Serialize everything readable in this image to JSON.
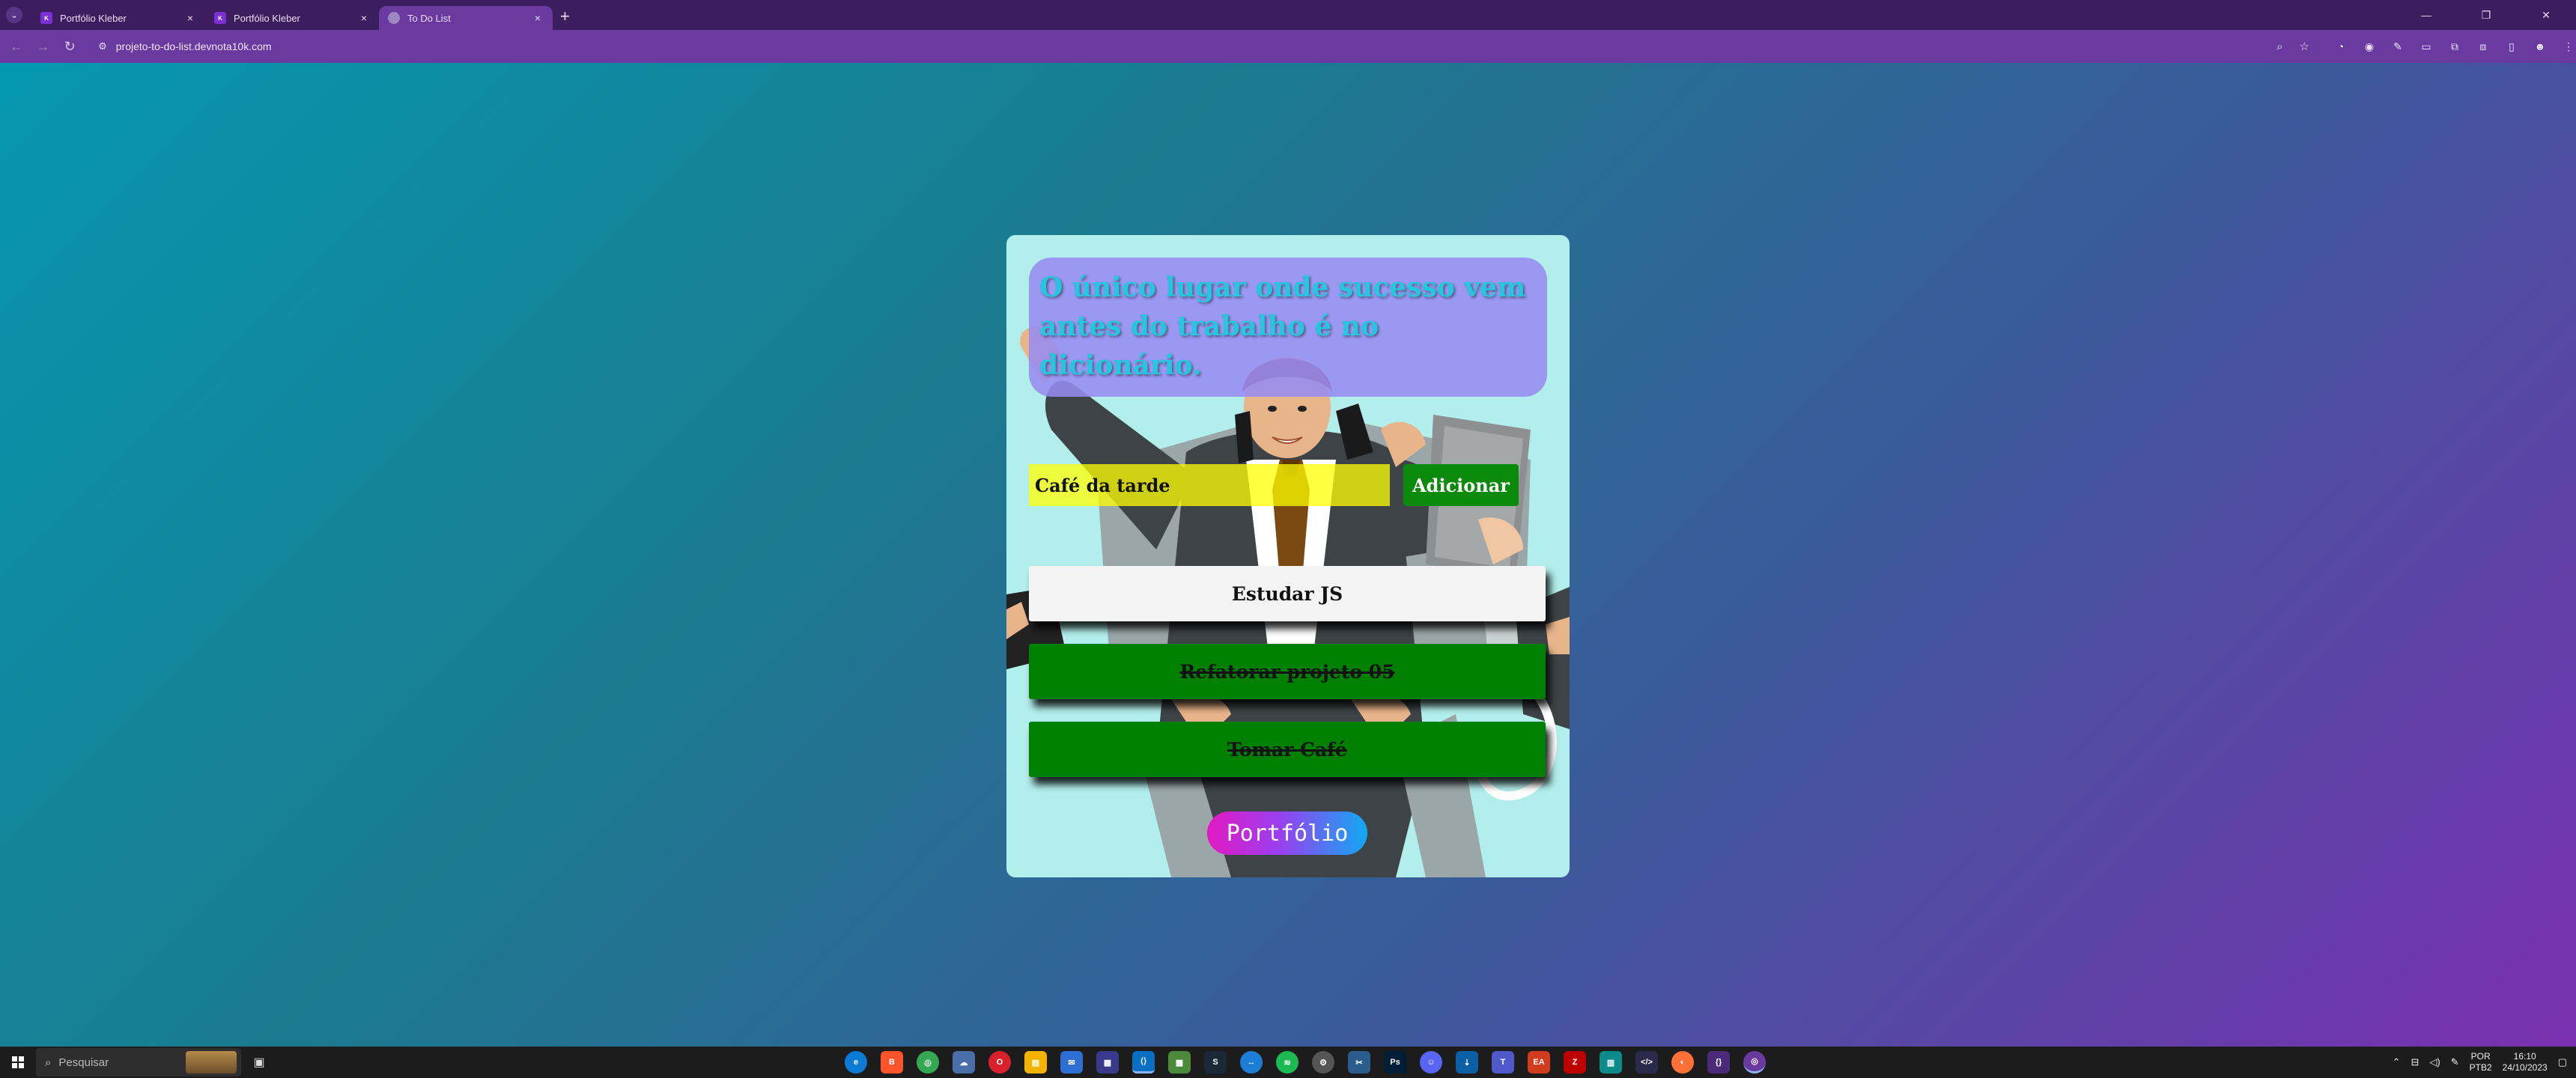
{
  "browser": {
    "tabs": [
      {
        "title": "Portfólio Kleber",
        "active": false,
        "favicon": "K"
      },
      {
        "title": "Portfólio Kleber",
        "active": false,
        "favicon": "K"
      },
      {
        "title": "To Do List",
        "active": true,
        "favicon": "globe-icon"
      }
    ],
    "url": "projeto-to-do-list.devnota10k.com"
  },
  "app": {
    "quote": "O único lugar onde sucesso vem antes do trabalho é no dicionário.",
    "input_value": "Café da tarde",
    "add_label": "Adicionar",
    "tasks": [
      {
        "text": "Estudar JS",
        "done": false
      },
      {
        "text": "Refatorar projeto 05",
        "done": true
      },
      {
        "text": "Tomar Café",
        "done": true
      }
    ],
    "portfolio_label": "Portfólio",
    "colors": {
      "quote_bg": "#968cf0",
      "quote_text": "#25c6e0",
      "input_bg": "#ffff00",
      "add_button": "#0b8a0b",
      "task_done_bg": "#008000",
      "task_pending_bg": "#f4f4f4",
      "card_bg": "#b2efec"
    }
  },
  "taskbar": {
    "search_placeholder": "Pesquisar",
    "language": "POR",
    "layout": "PTB2",
    "time": "16:10",
    "date": "24/10/2023"
  }
}
